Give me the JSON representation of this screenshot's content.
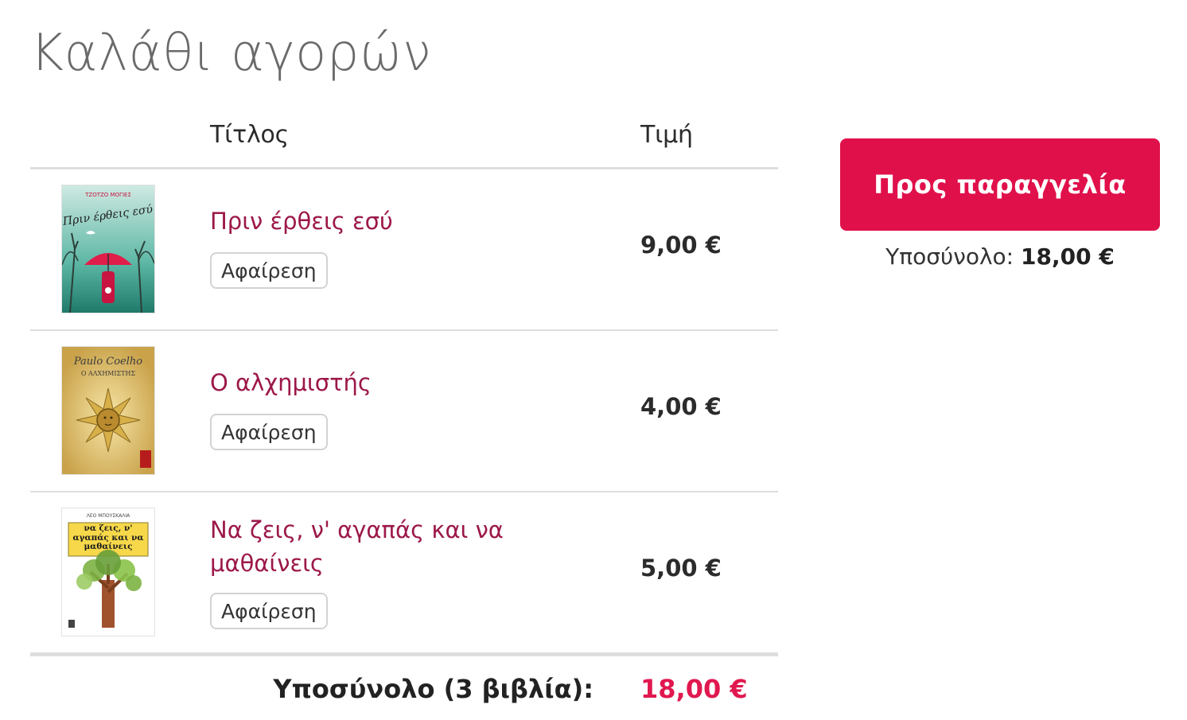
{
  "page": {
    "title": "Καλάθι αγορών"
  },
  "table": {
    "header_title": "Τίτλος",
    "header_price": "Τιμή"
  },
  "items": [
    {
      "title": "Πριν έρθεις εσύ",
      "remove_label": "Αφαίρεση",
      "price": "9,00 €",
      "cover_text_top": "ΤΖΟΤΖΟ ΜΟΓΙΕΣ",
      "cover_text_script": "Πριν έρθεις εσύ"
    },
    {
      "title": "Ο αλχημιστής",
      "remove_label": "Αφαίρεση",
      "price": "4,00 €",
      "cover_text_top": "Paulo Coelho",
      "cover_text_sub": "Ο ΑΛΧΗΜΙΣΤΗΣ"
    },
    {
      "title": "Να ζεις, ν' αγαπάς και να μαθαίνεις",
      "remove_label": "Αφαίρεση",
      "price": "5,00 €",
      "cover_text_top": "ΛΕΟ ΜΠΟΥΣΚΑΛΙΑ",
      "cover_text_box": "να ζεις, ν' αγαπάς και να μαθαίνεις"
    }
  ],
  "footer": {
    "subtotal_label": "Υποσύνολο (3 βιβλία):",
    "subtotal_value": "18,00 €"
  },
  "sidebar": {
    "checkout_label": "Προς παραγγελία",
    "subtotal_prefix": "Υποσύνολο:",
    "subtotal_value": "18,00 €"
  },
  "colors": {
    "accent": "#e0104b",
    "title_link": "#9c1849",
    "heading": "#6a6a6a"
  }
}
